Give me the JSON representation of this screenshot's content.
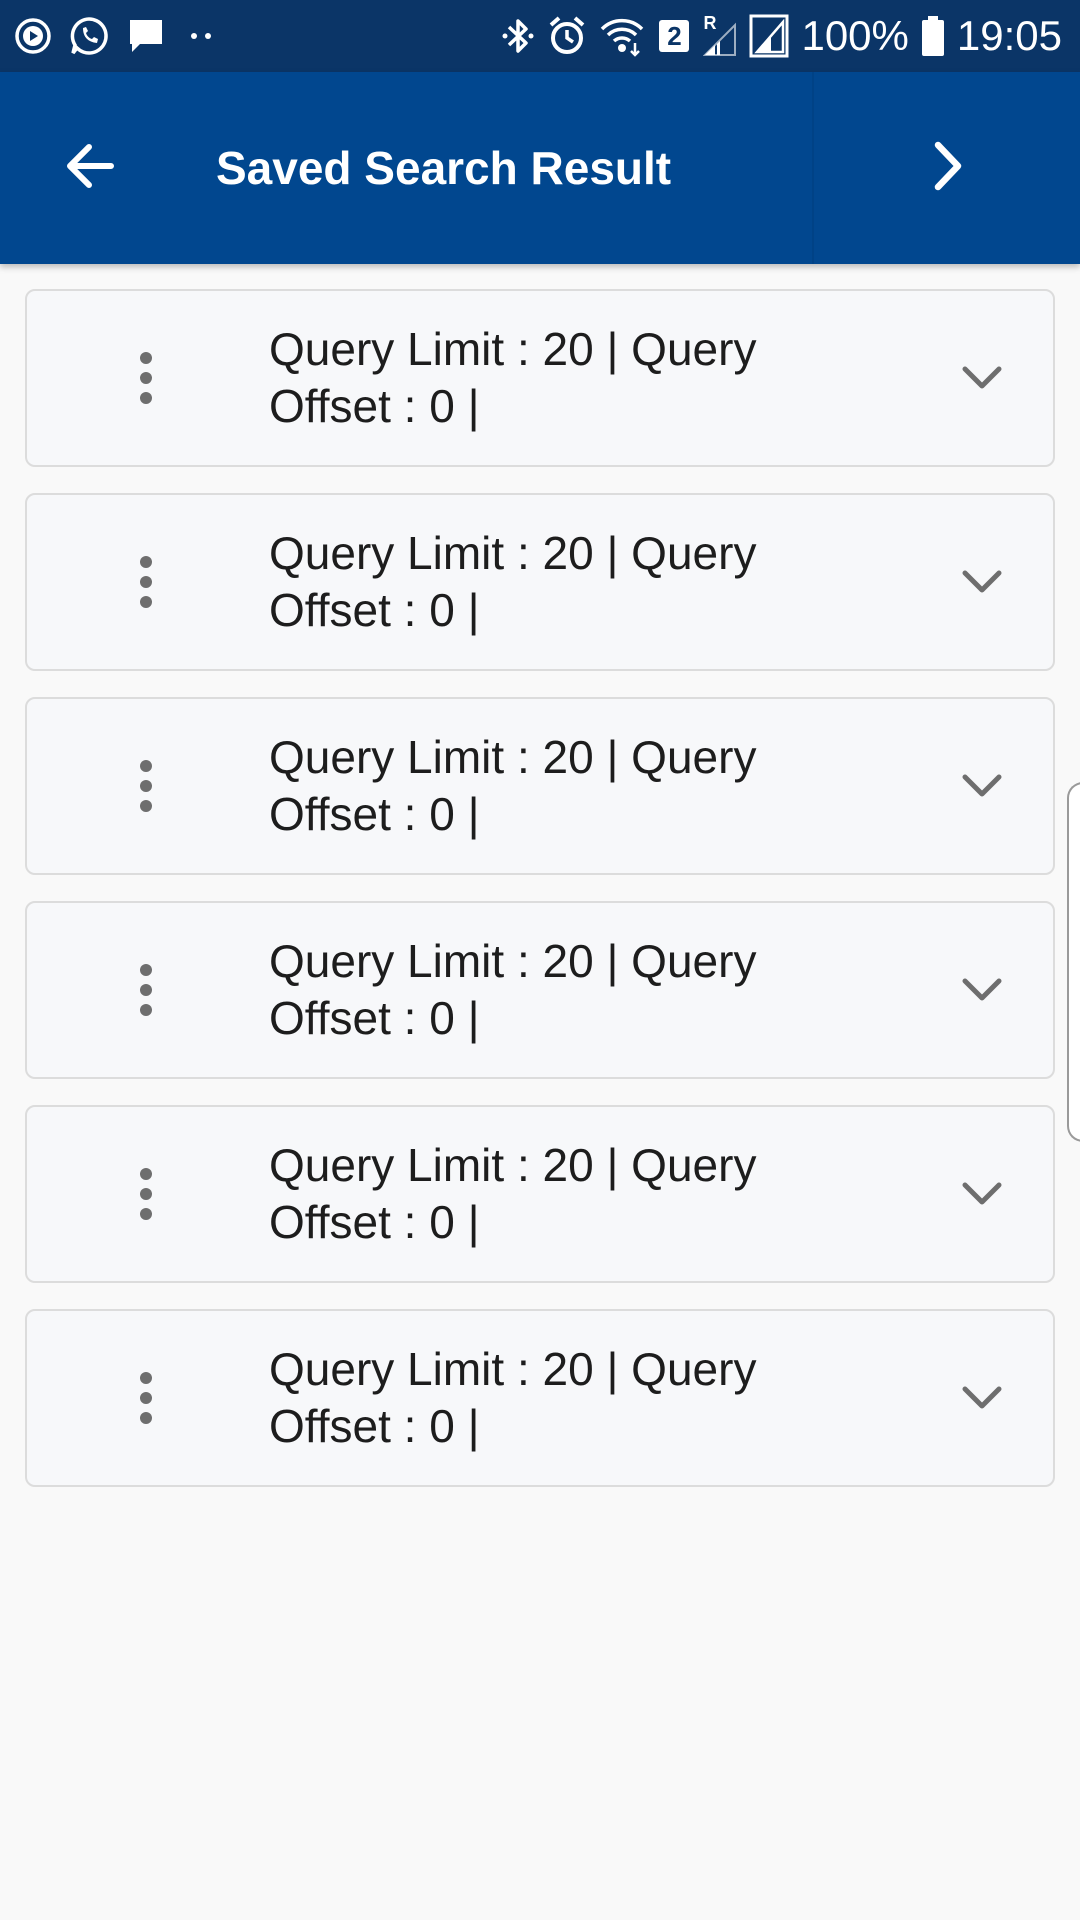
{
  "status_bar": {
    "battery_text": "100%",
    "time": "19:05",
    "sim_badge": "2",
    "roaming_label": "R",
    "left_icons": [
      "media-play-icon",
      "whatsapp-icon",
      "message-icon",
      "more-dots-icon"
    ],
    "right_icons": [
      "bluetooth-icon",
      "alarm-icon",
      "wifi-icon",
      "sim-2-icon",
      "signal-roaming-icon",
      "signal-icon",
      "battery-icon"
    ]
  },
  "app_bar": {
    "title": "Saved Search Result",
    "back_icon": "arrow-left-icon",
    "forward_icon": "chevron-right-icon",
    "background": "#01478f"
  },
  "results": [
    {
      "text": "Query Limit : 20 | Query Offset : 0 |"
    },
    {
      "text": "Query Limit : 20 | Query Offset : 0 |"
    },
    {
      "text": "Query Limit : 20 | Query Offset : 0 |"
    },
    {
      "text": "Query Limit : 20 | Query Offset : 0 |"
    },
    {
      "text": "Query Limit : 20 | Query Offset : 0 |"
    },
    {
      "text": "Query Limit : 20 | Query Offset : 0 |"
    }
  ],
  "icons": {
    "card_menu": "more-vertical-icon",
    "card_expand": "chevron-down-icon"
  },
  "colors": {
    "status_bar": "#0b3567",
    "app_bar": "#01478f",
    "page_background": "#f9f9f9",
    "card_background": "#f7f8fa",
    "card_border": "#dcdcdc",
    "icon_gray": "#6e6e6e"
  }
}
